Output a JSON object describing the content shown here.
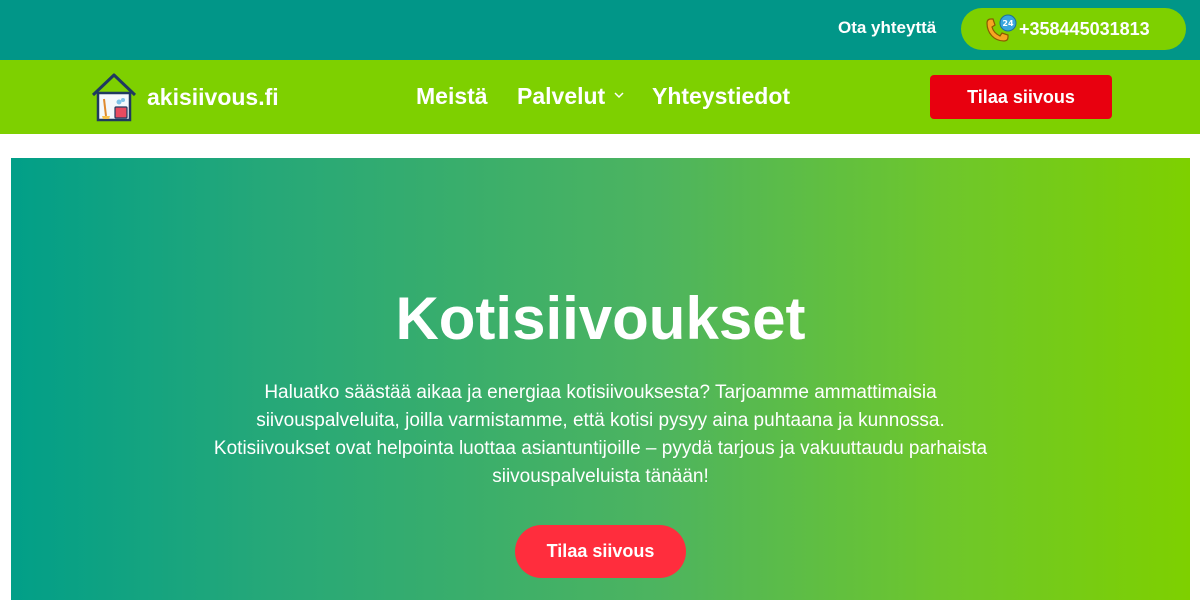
{
  "topbar": {
    "contact_label": "Ota yhteyttä",
    "phone_number": "+358445031813",
    "phone_icon": "phone-24h-icon"
  },
  "navbar": {
    "logo_text": "akisiivous.fi",
    "logo_icon": "house-cleaning-icon",
    "items": [
      {
        "label": "Meistä"
      },
      {
        "label": "Palvelut",
        "has_dropdown": true
      },
      {
        "label": "Yhteystiedot"
      }
    ],
    "cta_label": "Tilaa siivous"
  },
  "hero": {
    "title": "Kotisiivoukset",
    "text": "Haluatko säästää aikaa ja energiaa kotisiivouksesta? Tarjoamme ammattimaisia siivouspalveluita, joilla varmistamme, että kotisi pysyy aina puhtaana ja kunnossa. Kotisiivoukset ovat helpointa luottaa asiantuntijoille – pyydä tarjous ja vakuuttaudu parhaista siivouspalveluista tänään!",
    "cta_label": "Tilaa siivous"
  },
  "colors": {
    "topbar": "#019688",
    "navbar": "#7ed000",
    "nav_cta": "#e8000f",
    "hero_cta": "#ff2d3d"
  }
}
